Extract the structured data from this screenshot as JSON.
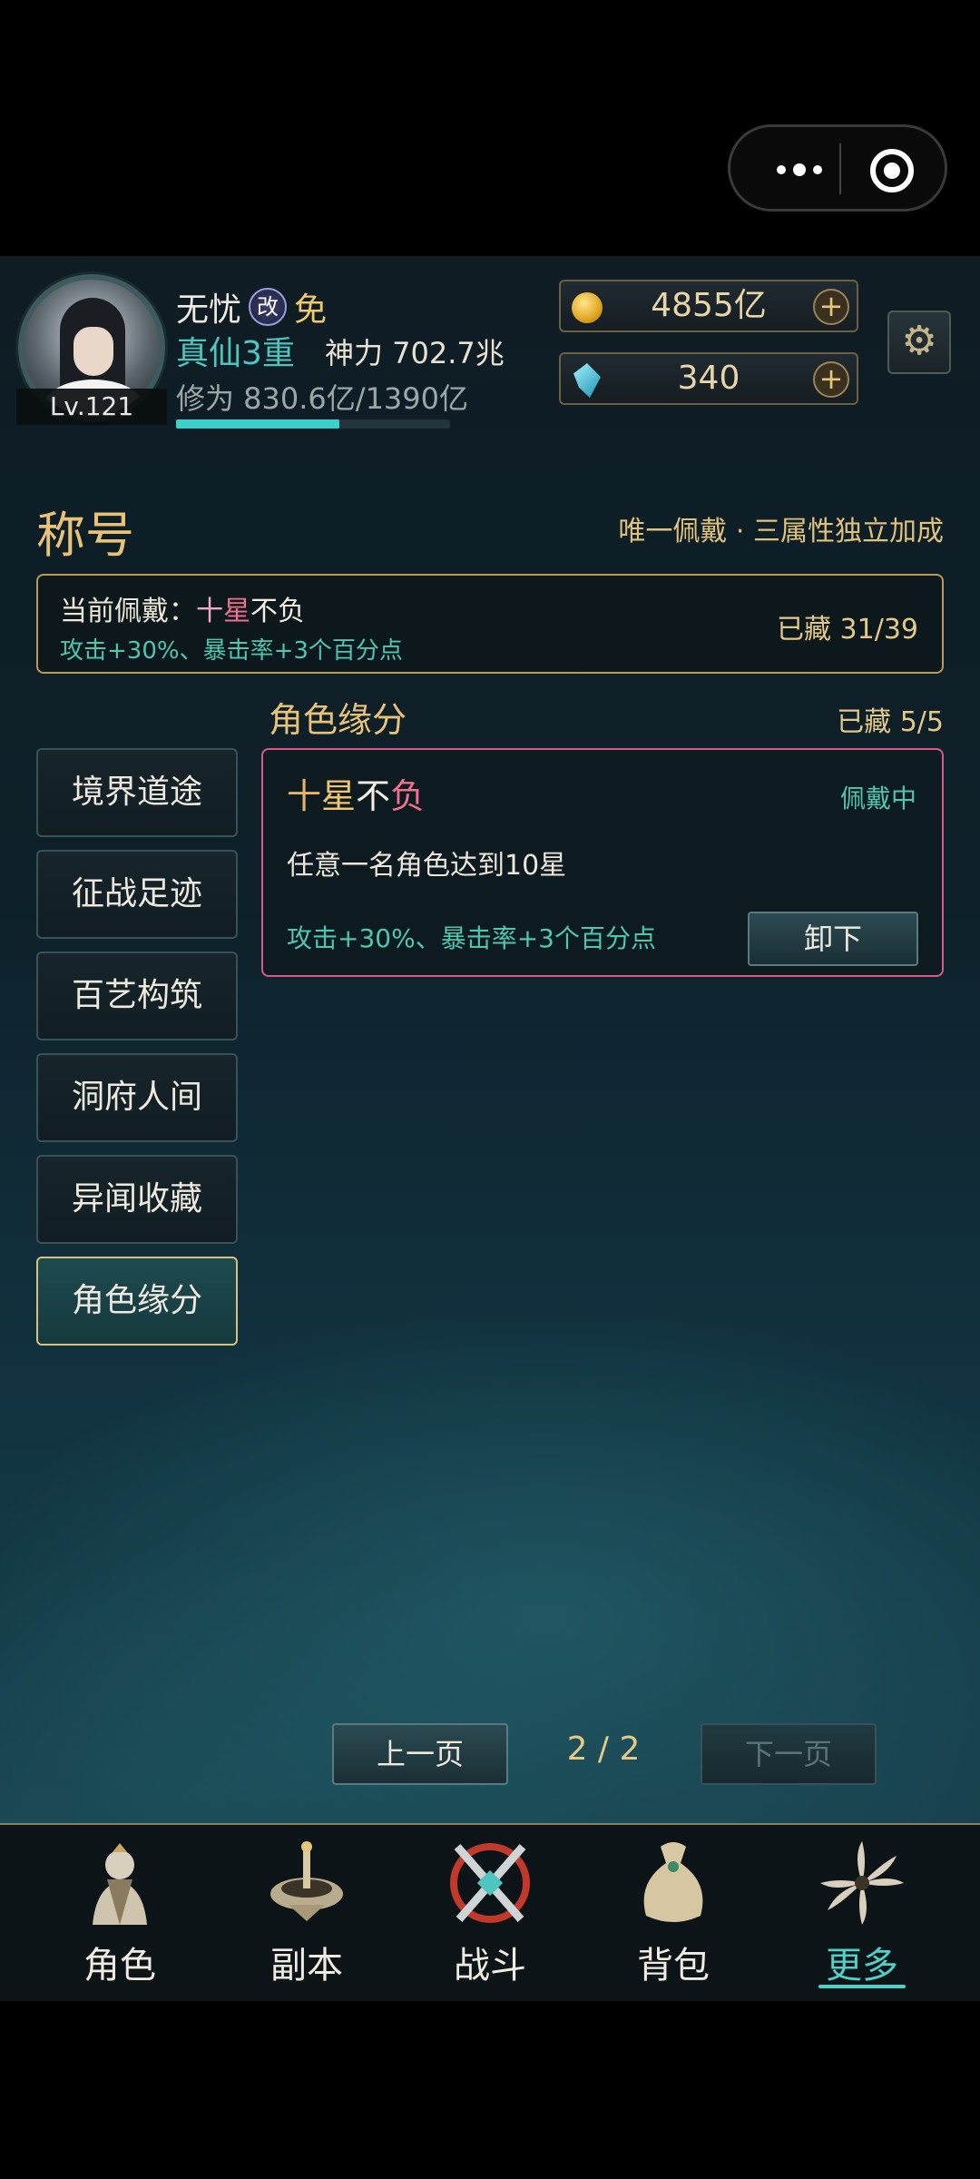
{
  "player": {
    "name": "无忧",
    "gai_badge": "改",
    "mian_badge": "免",
    "level": "Lv.121",
    "realm": "真仙3重",
    "power": "神力 702.7兆",
    "cultivation": "修为 830.6亿/1390亿",
    "cultivation_progress": 0.597
  },
  "resources": {
    "gold": "4855亿",
    "crystal": "340",
    "add_icon": "+"
  },
  "settings_icon": "gear-icon",
  "section": {
    "title": "称号",
    "hint": "唯一佩戴 · 三属性独立加成"
  },
  "current": {
    "label_prefix": "当前佩戴：",
    "title_shi": "十",
    "title_xing": "星",
    "title_rest": "不负",
    "bonus": "攻击+30%、暴击率+3个百分点",
    "collected": "已藏 31/39"
  },
  "categories": [
    {
      "label": "境界道途"
    },
    {
      "label": "征战足迹"
    },
    {
      "label": "百艺构筑"
    },
    {
      "label": "洞府人间"
    },
    {
      "label": "异闻收藏"
    },
    {
      "label": "角色缘分"
    }
  ],
  "panel": {
    "title": "角色缘分",
    "count": "已藏 5/5",
    "card": {
      "name_shi": "十",
      "name_xing": "星",
      "name_bu": "不",
      "name_fu": "负",
      "status": "佩戴中",
      "desc": "任意一名角色达到10星",
      "bonus": "攻击+30%、暴击率+3个百分点",
      "button": "卸下"
    }
  },
  "pager": {
    "prev": "上一页",
    "page": "2 / 2",
    "next": "下一页"
  },
  "nav": [
    {
      "label": "角色"
    },
    {
      "label": "副本"
    },
    {
      "label": "战斗"
    },
    {
      "label": "背包"
    },
    {
      "label": "更多"
    }
  ],
  "colors": {
    "accent_teal": "#4ec6c0",
    "gold_text": "#e9c27a",
    "card_border": "#d65a86"
  }
}
